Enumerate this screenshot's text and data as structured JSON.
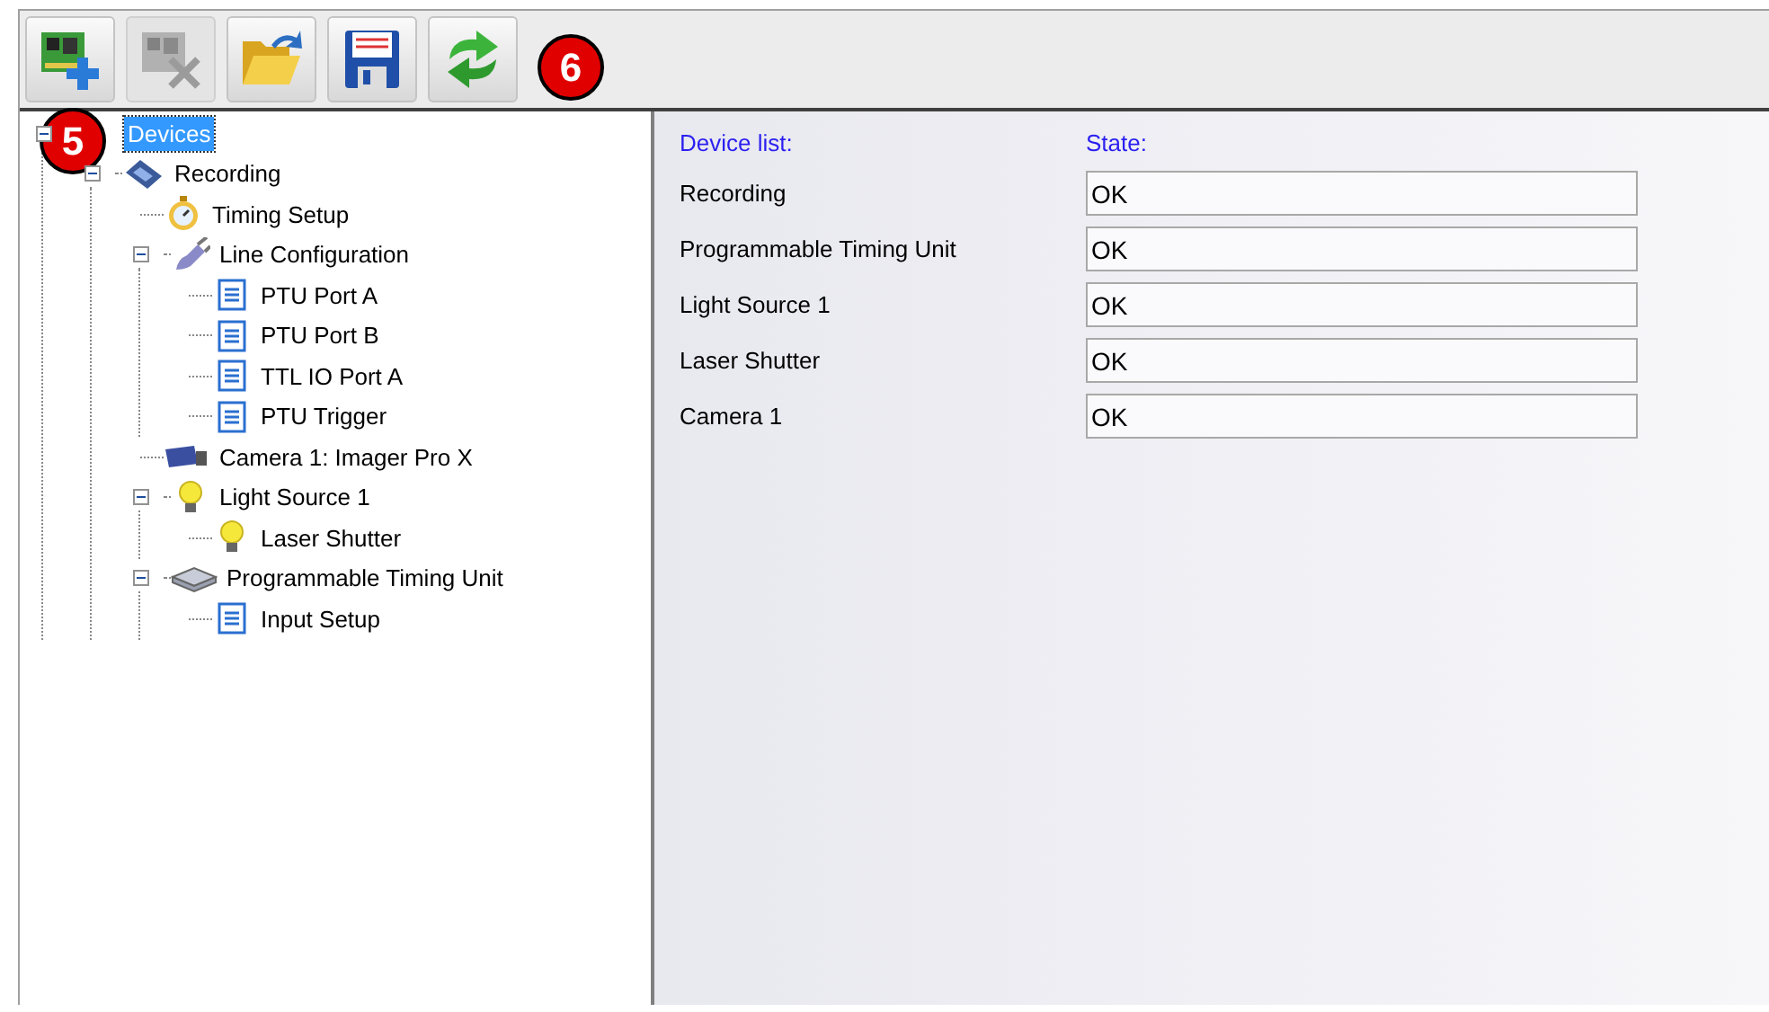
{
  "toolbar": {
    "buttons": [
      {
        "kind": "add-device",
        "disabled": false
      },
      {
        "kind": "remove-device",
        "disabled": true
      },
      {
        "kind": "open",
        "disabled": false
      },
      {
        "kind": "save",
        "disabled": false
      },
      {
        "kind": "refresh",
        "disabled": false
      }
    ]
  },
  "callouts": [
    {
      "label": "5"
    },
    {
      "label": "6"
    }
  ],
  "tree": [
    {
      "label": "Devices",
      "selected": true,
      "expanded": true,
      "children": [
        {
          "label": "Recording",
          "kind": "film",
          "selected": false,
          "expanded": true,
          "children": [
            {
              "label": "Timing Setup",
              "kind": "stopwatch",
              "selected": false
            },
            {
              "label": "Line Configuration",
              "kind": "plug",
              "selected": false,
              "expanded": true,
              "children": [
                {
                  "label": "PTU Port A",
                  "kind": "document",
                  "selected": false
                },
                {
                  "label": "PTU Port B",
                  "kind": "document",
                  "selected": false
                },
                {
                  "label": "TTL IO Port A",
                  "kind": "document",
                  "selected": false
                },
                {
                  "label": "PTU Trigger",
                  "kind": "document",
                  "selected": false
                }
              ]
            },
            {
              "label": "Camera 1: Imager Pro X",
              "kind": "camera",
              "selected": false
            },
            {
              "label": "Light Source 1",
              "kind": "bulb",
              "selected": false,
              "expanded": true,
              "children": [
                {
                  "label": "Laser Shutter",
                  "kind": "bulb",
                  "selected": false
                }
              ]
            },
            {
              "label": "Programmable Timing Unit",
              "kind": "device",
              "selected": false,
              "expanded": true,
              "children": [
                {
                  "label": "Input Setup",
                  "kind": "document",
                  "selected": false
                }
              ]
            }
          ]
        }
      ]
    }
  ],
  "status_panel": {
    "device_header": "Device list:",
    "state_header": "State:",
    "rows": [
      {
        "device": "Recording",
        "state": "OK"
      },
      {
        "device": "Programmable Timing Unit",
        "state": "OK"
      },
      {
        "device": "Light Source 1",
        "state": "OK"
      },
      {
        "device": "Laser Shutter",
        "state": "OK"
      },
      {
        "device": "Camera 1",
        "state": "OK"
      }
    ]
  }
}
